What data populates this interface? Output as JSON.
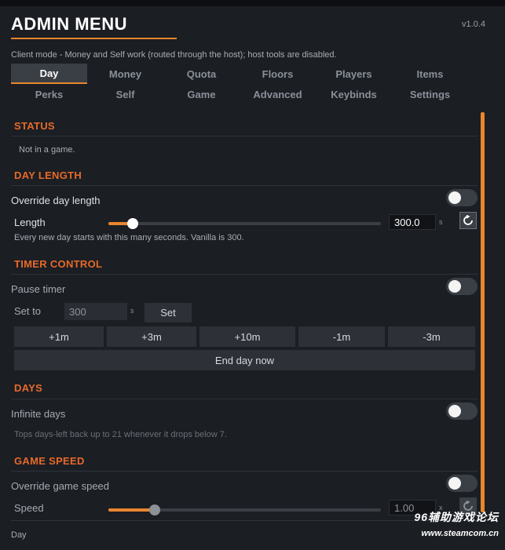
{
  "header": {
    "title": "ADMIN MENU",
    "version": "v1.0.4",
    "mode_note": "Client mode - Money and Self work (routed through the host); host tools are disabled."
  },
  "tabs": {
    "row1": [
      "Day",
      "Money",
      "Quota",
      "Floors",
      "Players",
      "Items"
    ],
    "row2": [
      "Perks",
      "Self",
      "Game",
      "Advanced",
      "Keybinds",
      "Settings"
    ],
    "active": "Day"
  },
  "status": {
    "heading": "STATUS",
    "text": "Not in a game."
  },
  "day_length": {
    "heading": "DAY LENGTH",
    "override_label": "Override day length",
    "override_on": false,
    "length_label": "Length",
    "length_value": "300.0",
    "length_unit": "s",
    "length_fraction": 0.09,
    "hint": "Every new day starts with this many seconds. Vanilla is 300."
  },
  "timer_control": {
    "heading": "TIMER CONTROL",
    "pause_label": "Pause timer",
    "pause_on": false,
    "set_to_label": "Set to",
    "set_to_placeholder": "300",
    "set_to_unit": "s",
    "set_button": "Set",
    "adjust_buttons": [
      "+1m",
      "+3m",
      "+10m",
      "-1m",
      "-3m"
    ],
    "end_day_button": "End day now"
  },
  "days": {
    "heading": "DAYS",
    "infinite_label": "Infinite days",
    "infinite_on": false,
    "hint": "Tops days-left back up to 21 whenever it drops below 7."
  },
  "game_speed": {
    "heading": "GAME SPEED",
    "override_label": "Override game speed",
    "override_on": false,
    "speed_label": "Speed",
    "speed_value": "1.00",
    "speed_unit": "x",
    "speed_fraction": 0.17
  },
  "footer": {
    "text": "Day"
  },
  "watermark": {
    "line1": "96辅助游戏论坛",
    "line2": "www.steamcom.cn"
  },
  "colors": {
    "accent": "#e8862e",
    "section_heading": "#e66a2a",
    "background": "#1b1e23"
  }
}
